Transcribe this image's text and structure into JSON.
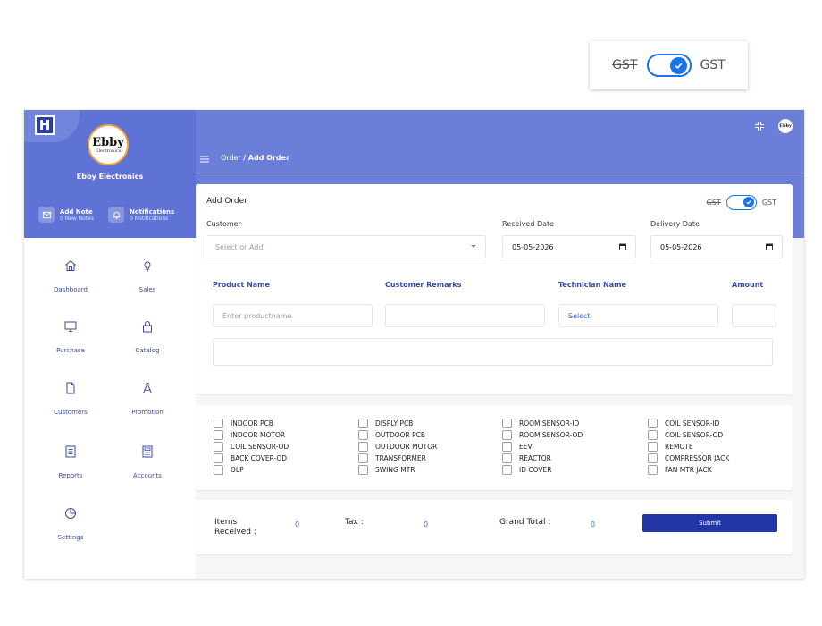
{
  "gst_toggle": {
    "off_label": "GST",
    "on_label": "GST",
    "state": "on",
    "accent": "#1a73e8"
  },
  "brand": {
    "logo_letter": "H",
    "badge_main": "Ebby",
    "badge_sub": "Electronics",
    "name": "Ebby Electronics",
    "avatar_text": "Ebby"
  },
  "quick": {
    "note_title": "Add Note",
    "note_sub": "0 New Notes",
    "notif_title": "Notifications",
    "notif_sub": "0 Notifications"
  },
  "nav": [
    {
      "label": "Dashboard",
      "icon": "home-icon"
    },
    {
      "label": "Sales",
      "icon": "bulb-icon"
    },
    {
      "label": "Purchase",
      "icon": "monitor-icon"
    },
    {
      "label": "Catalog",
      "icon": "lock-icon"
    },
    {
      "label": "Customers",
      "icon": "file-icon"
    },
    {
      "label": "Promotion",
      "icon": "compass-icon"
    },
    {
      "label": "Reports",
      "icon": "report-icon"
    },
    {
      "label": "Accounts",
      "icon": "calculator-icon"
    },
    {
      "label": "Settings",
      "icon": "pie-icon"
    }
  ],
  "breadcrumb": {
    "parent": "Order",
    "sep": "/",
    "current": "Add Order"
  },
  "order": {
    "title": "Add Order",
    "customer_label": "Customer",
    "customer_placeholder": "Select or Add",
    "received_label": "Received Date",
    "received_value": "05-05-2026",
    "delivery_label": "Delivery Date",
    "delivery_value": "05-05-2026",
    "col_product": "Product Name",
    "col_remarks": "Customer Remarks",
    "col_technician": "Technician Name",
    "col_amount": "Amount",
    "product_placeholder": "Enter productname",
    "technician_value": "Select"
  },
  "checklist": [
    [
      "INDOOR PCB",
      "INDOOR MOTOR",
      "COIL SENSOR-OD",
      "BACK COVER-OD",
      "OLP"
    ],
    [
      "DISPLY PCB",
      "OUTDOOR PCB",
      "OUTDOOR MOTOR",
      "TRANSFORMER",
      "SWING MTR"
    ],
    [
      "ROOM SENSOR-ID",
      "ROOM SENSOR-OD",
      "EEV",
      "REACTOR",
      "ID COVER"
    ],
    [
      "COIL SENSOR-ID",
      "COIL SENSOR-OD",
      "REMOTE",
      "COMPRESSOR JACK",
      "FAN MTR JACK"
    ]
  ],
  "totals": {
    "items_label_1": "Items",
    "items_label_2": "Received :",
    "items_value": "0",
    "tax_label": "Tax :",
    "tax_value": "0",
    "grand_label": "Grand Total :",
    "grand_value": "0",
    "submit_label": "Submit"
  }
}
